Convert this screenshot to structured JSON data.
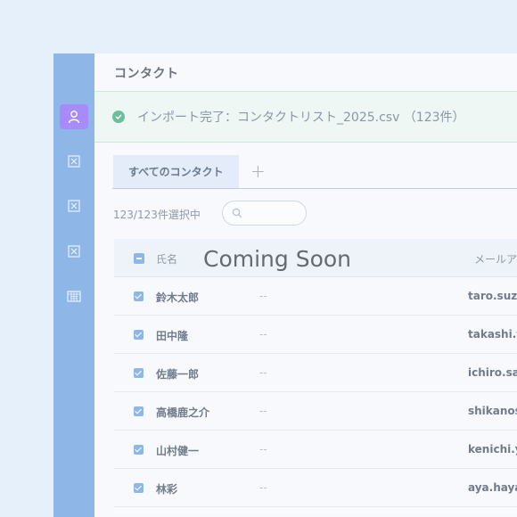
{
  "page": {
    "title": "コンタクト"
  },
  "banner": {
    "text": "インポート完了：コンタクトリスト_2025.csv （123件）"
  },
  "tabs": {
    "active_label": "すべてのコンタクト",
    "add_symbol": "+"
  },
  "selection": {
    "count_text": "123/123件選択中"
  },
  "table": {
    "headers": {
      "name": "氏名",
      "email": "メールア"
    },
    "overlay": "Coming Soon",
    "rows": [
      {
        "name": "鈴木太郎",
        "mid": "--",
        "email": "taro.suzu"
      },
      {
        "name": "田中隆",
        "mid": "--",
        "email": "takashi.ta"
      },
      {
        "name": "佐藤一郎",
        "mid": "--",
        "email": "ichiro.sat"
      },
      {
        "name": "高橋鹿之介",
        "mid": "--",
        "email": "shikanosu"
      },
      {
        "name": "山村健一",
        "mid": "--",
        "email": "kenichi.ya"
      },
      {
        "name": "林彩",
        "mid": "--",
        "email": "aya.hayas"
      }
    ]
  },
  "sidebar": {
    "icons": [
      "user-icon",
      "close-box-icon",
      "close-box-icon",
      "close-box-icon",
      "calendar-icon"
    ]
  },
  "colors": {
    "rail": "#8eb7e8",
    "active": "#a78bfa",
    "success": "#6bbf9b"
  }
}
